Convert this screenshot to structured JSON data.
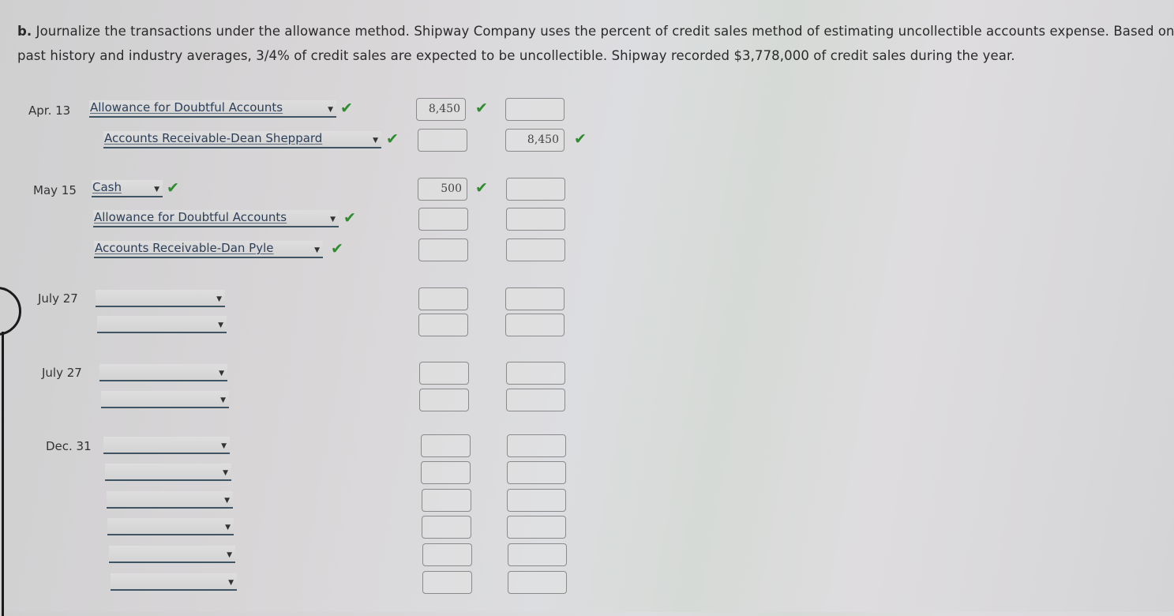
{
  "instructions": {
    "part_label": "b.",
    "line1": "Journalize the transactions under the allowance method. Shipway Company uses the percent of credit sales method of estimating uncollectible accounts expense. Based on",
    "line2": "past history and industry averages, 3/4% of credit sales are expected to be uncollectible. Shipway recorded $3,778,000 of credit sales during the year."
  },
  "entries": [
    {
      "date": "Apr. 13",
      "rows": [
        {
          "account": "Allowance for Doubtful Accounts",
          "account_check": true,
          "debit": "8,450",
          "debit_check": true,
          "credit": "",
          "credit_check": false
        },
        {
          "account": "Accounts Receivable-Dean Sheppard",
          "account_check": true,
          "debit": "",
          "debit_check": false,
          "credit": "8,450",
          "credit_check": true
        }
      ]
    },
    {
      "date": "May 15",
      "rows": [
        {
          "account": "Cash",
          "account_check": true,
          "debit": "500",
          "debit_check": true,
          "credit": "",
          "credit_check": false
        },
        {
          "account": "Allowance for Doubtful Accounts",
          "account_check": true,
          "debit": "",
          "debit_check": false,
          "credit": "",
          "credit_check": false
        },
        {
          "account": "Accounts Receivable-Dan Pyle",
          "account_check": true,
          "debit": "",
          "debit_check": false,
          "credit": "",
          "credit_check": false
        }
      ]
    },
    {
      "date": "July 27",
      "rows": [
        {
          "account": "",
          "debit": "",
          "credit": ""
        },
        {
          "account": "",
          "debit": "",
          "credit": ""
        }
      ]
    },
    {
      "date": "July 27",
      "rows": [
        {
          "account": "",
          "debit": "",
          "credit": ""
        },
        {
          "account": "",
          "debit": "",
          "credit": ""
        }
      ]
    },
    {
      "date": "Dec. 31",
      "rows": [
        {
          "account": "",
          "debit": "",
          "credit": ""
        },
        {
          "account": "",
          "debit": "",
          "credit": ""
        },
        {
          "account": "",
          "debit": "",
          "credit": ""
        },
        {
          "account": "",
          "debit": "",
          "credit": ""
        },
        {
          "account": "",
          "debit": "",
          "credit": ""
        },
        {
          "account": "",
          "debit": "",
          "credit": ""
        }
      ]
    }
  ],
  "icons": {
    "check": "✔",
    "caret": "▼"
  },
  "colors": {
    "check_green": "#2e8b2e",
    "account_text": "#2d3f58"
  }
}
